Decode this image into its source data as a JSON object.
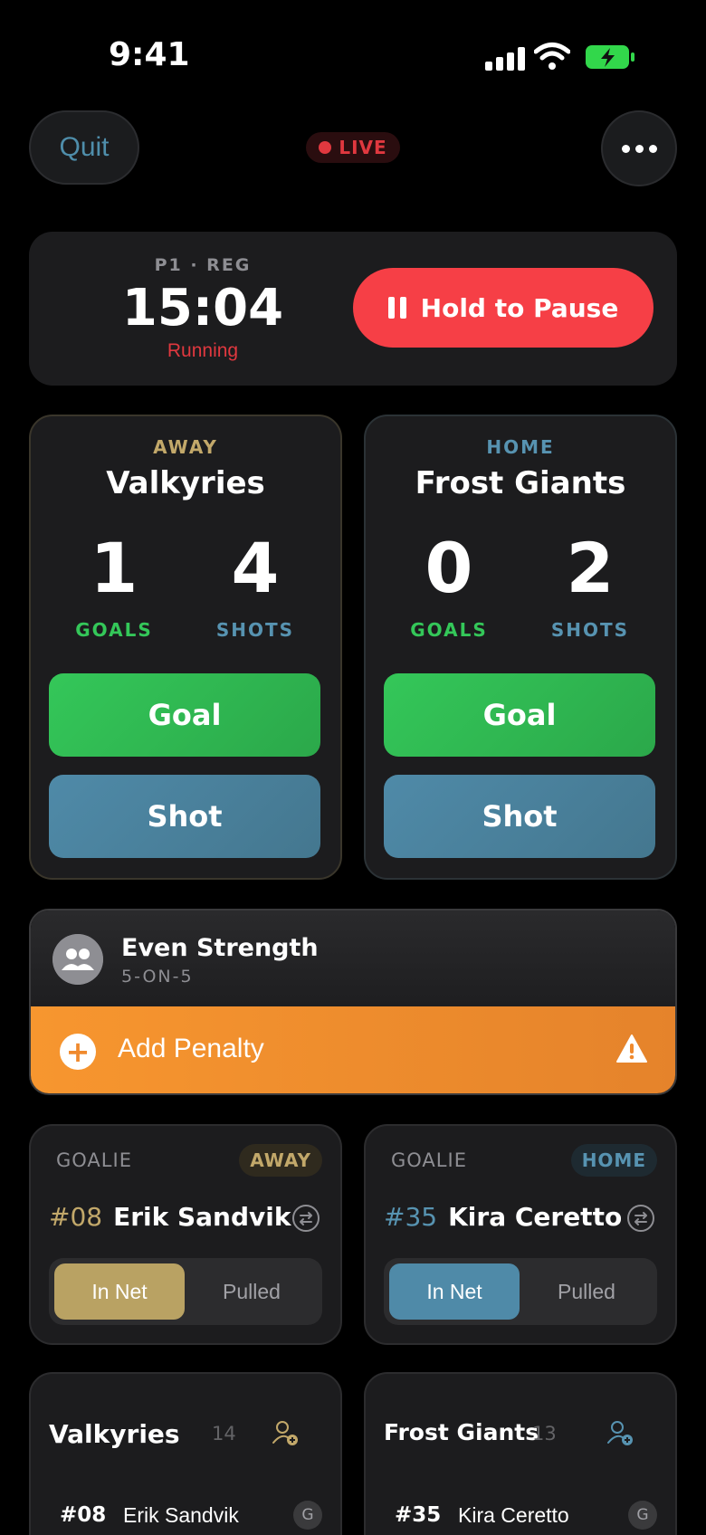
{
  "status_bar": {
    "time": "9:41"
  },
  "header": {
    "quit_label": "Quit",
    "live_label": "LIVE"
  },
  "clock": {
    "period": "P1 · REG",
    "time": "15:04",
    "state": "Running",
    "pause_label": "Hold to Pause"
  },
  "teams": {
    "away": {
      "side": "AWAY",
      "name": "Valkyries",
      "goals": "1",
      "shots": "4",
      "goals_label": "GOALS",
      "shots_label": "SHOTS",
      "goal_button": "Goal",
      "shot_button": "Shot"
    },
    "home": {
      "side": "HOME",
      "name": "Frost Giants",
      "goals": "0",
      "shots": "2",
      "goals_label": "GOALS",
      "shots_label": "SHOTS",
      "goal_button": "Goal",
      "shot_button": "Shot"
    }
  },
  "strength": {
    "title": "Even Strength",
    "subtitle": "5-ON-5",
    "penalty_label": "Add Penalty"
  },
  "goalies": {
    "away": {
      "label": "GOALIE",
      "tag": "AWAY",
      "number": "#08",
      "name": "Erik Sandvik",
      "in_net": "In Net",
      "pulled": "Pulled"
    },
    "home": {
      "label": "GOALIE",
      "tag": "HOME",
      "number": "#35",
      "name": "Kira Ceretto",
      "in_net": "In Net",
      "pulled": "Pulled"
    }
  },
  "rosters": {
    "away": {
      "title": "Valkyries",
      "count": "14",
      "rows": [
        {
          "number": "#08",
          "name": "Erik Sandvik",
          "position": "G"
        }
      ]
    },
    "home": {
      "title": "Frost Giants",
      "count": "13",
      "rows": [
        {
          "number": "#35",
          "name": "Kira Ceretto",
          "position": "G"
        }
      ]
    }
  },
  "colors": {
    "away_accent": "#c2a86a",
    "home_accent": "#5793b1",
    "goal_green": "#34c759",
    "live_red": "#e0383f",
    "penalty_orange": "#f7962f"
  },
  "icons": [
    "signal-icon",
    "wifi-icon",
    "battery-charging-icon",
    "more-icon",
    "pause-icon",
    "people-icon",
    "plus-circle-icon",
    "warning-icon",
    "swap-icon",
    "add-player-icon"
  ]
}
